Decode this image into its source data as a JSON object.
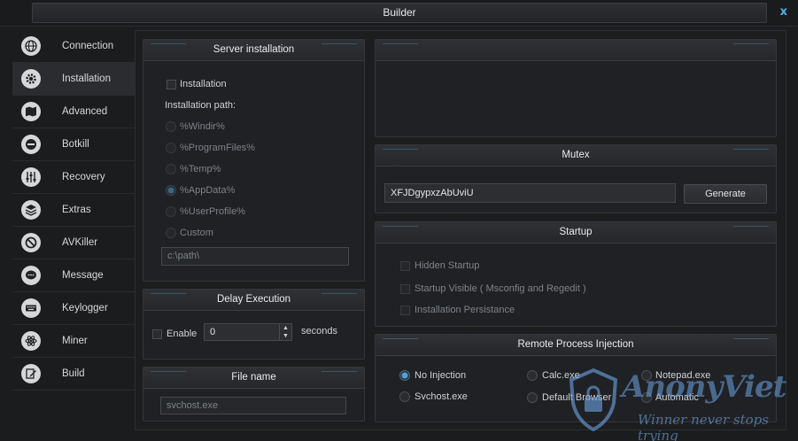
{
  "window": {
    "title": "Builder",
    "close": "x"
  },
  "sidebar": {
    "items": [
      {
        "label": "Connection",
        "icon": "globe-icon",
        "active": false
      },
      {
        "label": "Installation",
        "icon": "gear-icon",
        "active": true
      },
      {
        "label": "Advanced",
        "icon": "map-icon",
        "active": false
      },
      {
        "label": "Botkill",
        "icon": "minus-circle-icon",
        "active": false
      },
      {
        "label": "Recovery",
        "icon": "sliders-icon",
        "active": false
      },
      {
        "label": "Extras",
        "icon": "layers-icon",
        "active": false
      },
      {
        "label": "AVKiller",
        "icon": "ban-icon",
        "active": false
      },
      {
        "label": "Message",
        "icon": "chat-icon",
        "active": false
      },
      {
        "label": "Keylogger",
        "icon": "keyboard-icon",
        "active": false
      },
      {
        "label": "Miner",
        "icon": "atom-icon",
        "active": false
      },
      {
        "label": "Build",
        "icon": "edit-icon",
        "active": false
      }
    ]
  },
  "server_installation": {
    "title": "Server installation",
    "installation_checkbox": "Installation",
    "path_label": "Installation path:",
    "options": [
      "%Windir%",
      "%ProgramFiles%",
      "%Temp%",
      "%AppData%",
      "%UserProfile%",
      "Custom"
    ],
    "selected": "%AppData%",
    "custom_path": "c:\\path\\"
  },
  "delay_execution": {
    "title": "Delay Execution",
    "enable_label": "Enable",
    "value": "0",
    "unit": "seconds"
  },
  "file_name": {
    "title": "File name",
    "value": "svchost.exe"
  },
  "mutex": {
    "title": "Mutex",
    "value": "XFJDgypxzAbUviU",
    "generate_label": "Generate"
  },
  "startup": {
    "title": "Startup",
    "options": [
      "Hidden Startup",
      "Startup Visible ( Msconfig and Regedit )",
      "Installation Persistance"
    ]
  },
  "injection": {
    "title": "Remote Process Injection",
    "options": [
      "No Injection",
      "Calc.exe",
      "Notepad.exe",
      "Svchost.exe",
      "Default Browser",
      "Automatic"
    ],
    "selected": "No Injection"
  },
  "watermark": {
    "brand": "AnonyViet",
    "slogan": "Winner never stops trying"
  },
  "colors": {
    "accent": "#4aa3dd",
    "background": "#1b1c1e",
    "panel": "#202124"
  }
}
